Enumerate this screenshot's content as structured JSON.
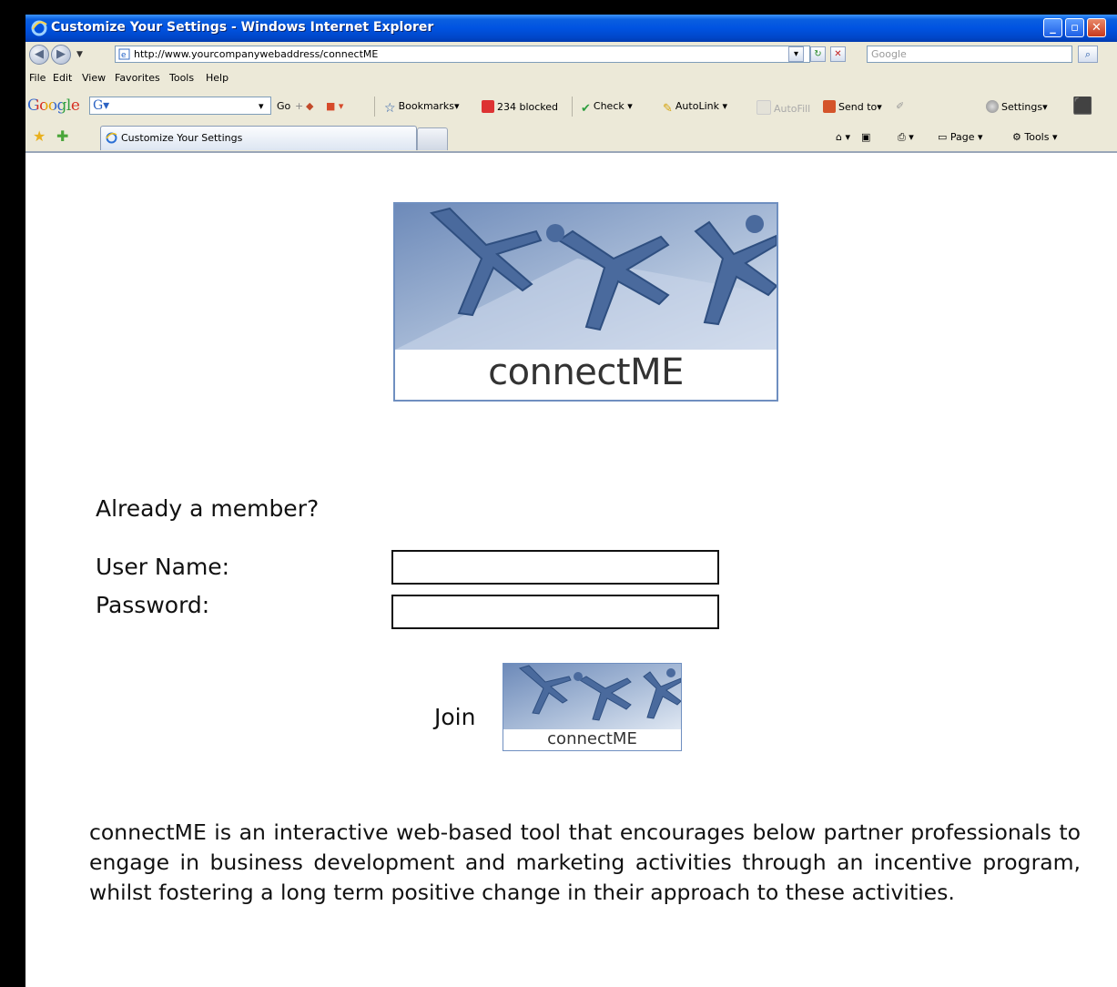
{
  "window": {
    "title": "Customize Your Settings - Windows Internet Explorer",
    "controls": [
      "minimize",
      "maximize",
      "close"
    ]
  },
  "addressbar": {
    "url": "http://www.yourcompanywebaddress/connectME",
    "search_placeholder": "Google"
  },
  "menubar": {
    "items": [
      "File",
      "Edit",
      "View",
      "Favorites",
      "Tools",
      "Help"
    ]
  },
  "google_toolbar": {
    "logo": "Google",
    "search_prefix": "G▾",
    "go": "Go",
    "bookmarks": "Bookmarks▾",
    "blocked": "234 blocked",
    "check": "Check ▾",
    "autolink": "AutoLink ▾",
    "autofill": "AutoFill",
    "sendto": "Send to▾",
    "settings": "Settings▾"
  },
  "tabbar": {
    "tab_label": "Customize Your Settings",
    "page": "Page ▾",
    "tools": "Tools ▾"
  },
  "content": {
    "logo_text": "connectME",
    "already_member": "Already a member?",
    "username_label": "User Name:",
    "password_label": "Password:",
    "join_label": "Join",
    "join_logo_text": "connectME",
    "description": "connectME is an interactive web-based tool that encourages below partner professionals to engage in business development and marketing activities through an incentive program,  whilst fostering a long term positive change in their approach to these activities."
  },
  "colors": {
    "titlebar": "#0053e1",
    "chrome": "#ece9d8",
    "logo_blue": "#6f8fc0"
  }
}
